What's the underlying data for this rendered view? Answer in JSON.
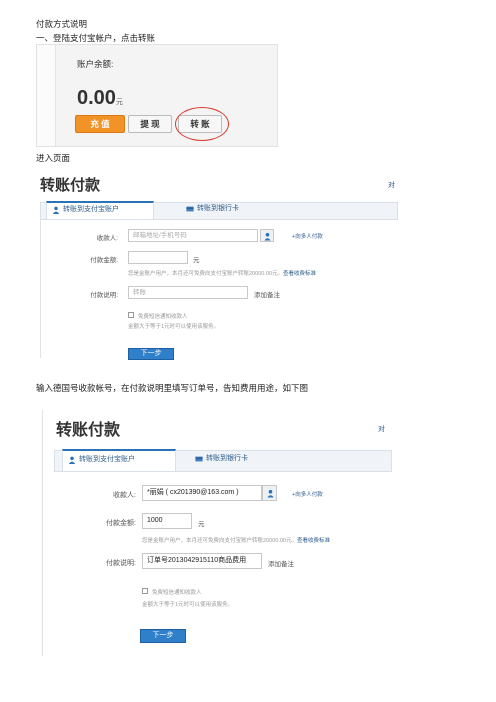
{
  "doc": {
    "heading": "付款方式说明",
    "step1": "一、登陆支付宝帐户，点击转账",
    "step2": "进入页面",
    "step3": "输入德国号收款帐号，在付款说明里填写订单号，告知费用用途，如下图"
  },
  "balance_panel": {
    "label": "账户余额:",
    "amount": "0.00",
    "unit": "元",
    "recharge_label": "充 值",
    "withdraw_label": "提 现",
    "transfer_label": "转 账"
  },
  "transfer_empty": {
    "title": "转账付款",
    "corner": "对",
    "tab_alipay": "转账到支付宝账户",
    "tab_bank": "转账到银行卡",
    "payee_label": "收款人:",
    "payee_placeholder": "邮箱地址/手机号码",
    "add_multi": "+向多人付款",
    "amount_label": "付款金额:",
    "amount_unit": "元",
    "amount_hint": "您是金账户用户，本月还可免费向支付宝账户转账20000.00元。",
    "fee_link": "查看收费标准",
    "note_label": "付款说明:",
    "note_placeholder": "转账",
    "add_note": "添加备注",
    "sms_label": "免费短信通知收款人",
    "sms_hint": "金额大于等于1元时可以使用该服务。",
    "next": "下一步"
  },
  "transfer_filled": {
    "title": "转账付款",
    "corner": "对",
    "tab_alipay": "转账到支付宝账户",
    "tab_bank": "转账到银行卡",
    "payee_label": "收款人:",
    "payee_value": "*丽娟 ( cx201390@163.com )",
    "add_multi": "+向多人付款",
    "amount_label": "付款金额:",
    "amount_value": "1000",
    "amount_unit": "元",
    "amount_hint": "您是金账户用户，本月还可免费向支付宝账户转账20000.00元。",
    "fee_link": "查看收费标准",
    "note_label": "付款说明:",
    "note_value": "订单号2013042915110商品费用",
    "add_note": "添加备注",
    "sms_label": "免费短信通知收款人",
    "sms_hint": "金额大于等于1元时可以使用该服务。",
    "next": "下一步"
  }
}
